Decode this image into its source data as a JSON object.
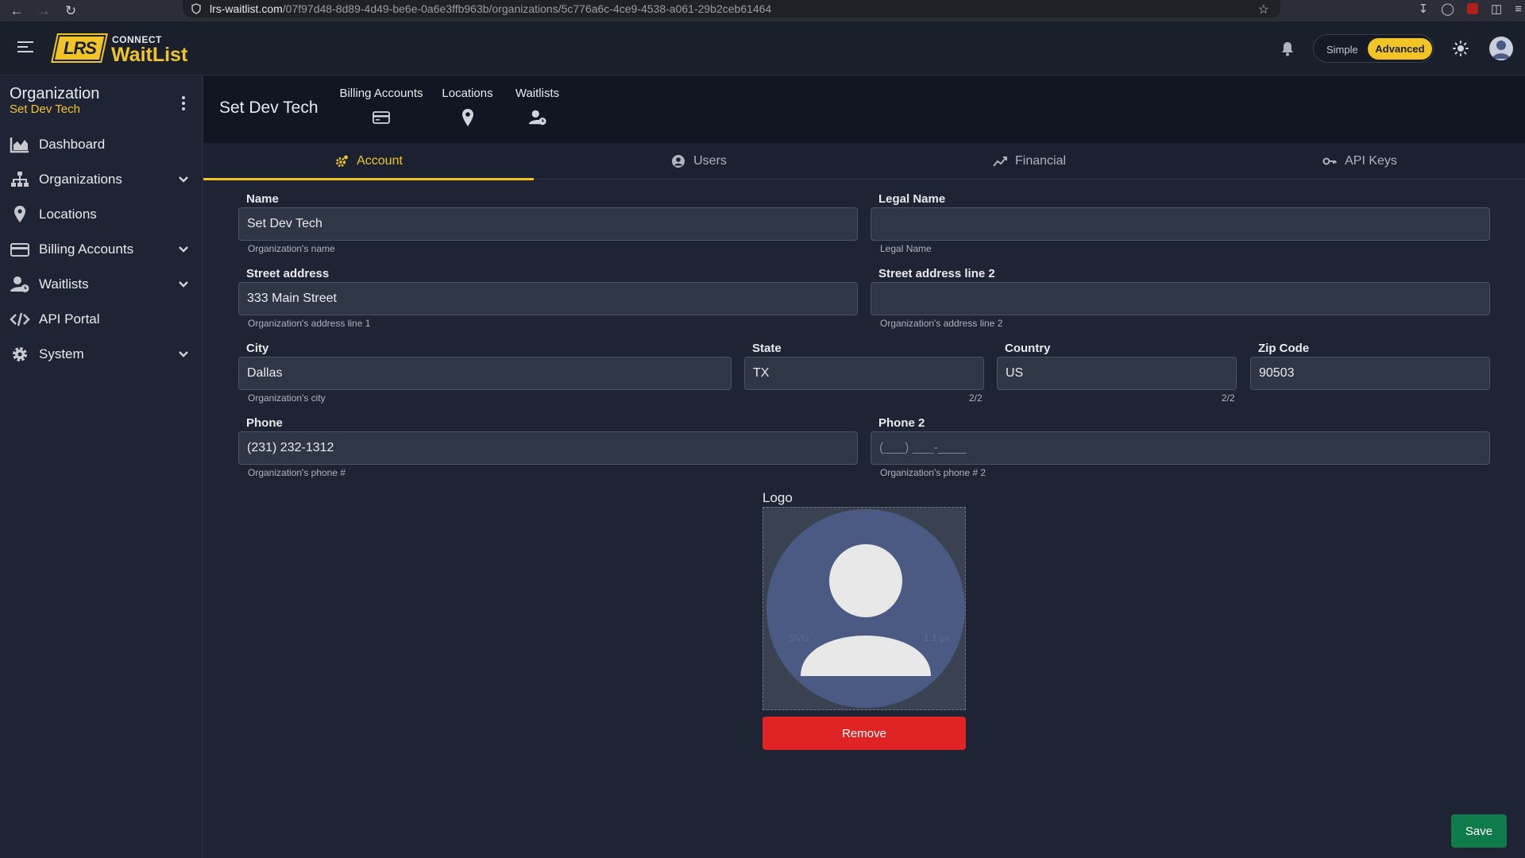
{
  "browser": {
    "url_host": "lrs-waitlist.com",
    "url_path": "/07f97d48-8d89-4d49-be6e-0a6e3ffb963b/organizations/5c776a6c-4ce9-4538-a061-29b2ceb61464"
  },
  "header": {
    "logo_mark": "LRS",
    "logo_top": "CONNECT",
    "logo_main": "WaitList",
    "mode_simple": "Simple",
    "mode_advanced": "Advanced",
    "mode_selected": "Advanced"
  },
  "sidebar": {
    "title": "Organization",
    "subtitle": "Set Dev Tech",
    "items": [
      {
        "label": "Dashboard",
        "icon": "chart-area-icon",
        "expandable": false
      },
      {
        "label": "Organizations",
        "icon": "sitemap-icon",
        "expandable": true
      },
      {
        "label": "Locations",
        "icon": "map-pin-icon",
        "expandable": false
      },
      {
        "label": "Billing Accounts",
        "icon": "credit-card-icon",
        "expandable": true
      },
      {
        "label": "Waitlists",
        "icon": "user-clock-icon",
        "expandable": true
      },
      {
        "label": "API Portal",
        "icon": "code-icon",
        "expandable": false
      },
      {
        "label": "System",
        "icon": "gear-icon",
        "expandable": true
      }
    ]
  },
  "org_header": {
    "name": "Set Dev Tech",
    "quick_links": [
      {
        "label": "Billing Accounts",
        "icon": "credit-card-icon"
      },
      {
        "label": "Locations",
        "icon": "map-pin-icon"
      },
      {
        "label": "Waitlists",
        "icon": "user-clock-icon"
      }
    ]
  },
  "tabs": [
    {
      "label": "Account",
      "icon": "gears-icon",
      "active": true
    },
    {
      "label": "Users",
      "icon": "user-circle-icon",
      "active": false
    },
    {
      "label": "Financial",
      "icon": "trend-line-icon",
      "active": false
    },
    {
      "label": "API Keys",
      "icon": "key-icon",
      "active": false
    }
  ],
  "form": {
    "name": {
      "label": "Name",
      "value": "Set Dev Tech",
      "hint": "Organization's name"
    },
    "legal_name": {
      "label": "Legal Name",
      "value": "",
      "hint": "Legal Name"
    },
    "street": {
      "label": "Street address",
      "value": "333 Main Street",
      "hint": "Organization's address line 1"
    },
    "street2": {
      "label": "Street address line 2",
      "value": "",
      "hint": "Organization's address line 2"
    },
    "city": {
      "label": "City",
      "value": "Dallas",
      "hint": "Organization's city"
    },
    "state": {
      "label": "State",
      "value": "TX",
      "counter": "2/2"
    },
    "country": {
      "label": "Country",
      "value": "US",
      "counter": "2/2"
    },
    "zip": {
      "label": "Zip Code",
      "value": "90503"
    },
    "phone": {
      "label": "Phone",
      "value": "(231) 232-1312",
      "hint": "Organization's phone #"
    },
    "phone2": {
      "label": "Phone 2",
      "placeholder": "(___) ___-____",
      "hint": "Organization's phone # 2"
    },
    "logo": {
      "label": "Logo",
      "hint_left": "SVG",
      "hint_right": "1:1 px",
      "remove": "Remove"
    }
  },
  "actions": {
    "save": "Save"
  },
  "colors": {
    "accent": "#f2c425",
    "danger": "#e02424",
    "success": "#0f7a4a"
  }
}
